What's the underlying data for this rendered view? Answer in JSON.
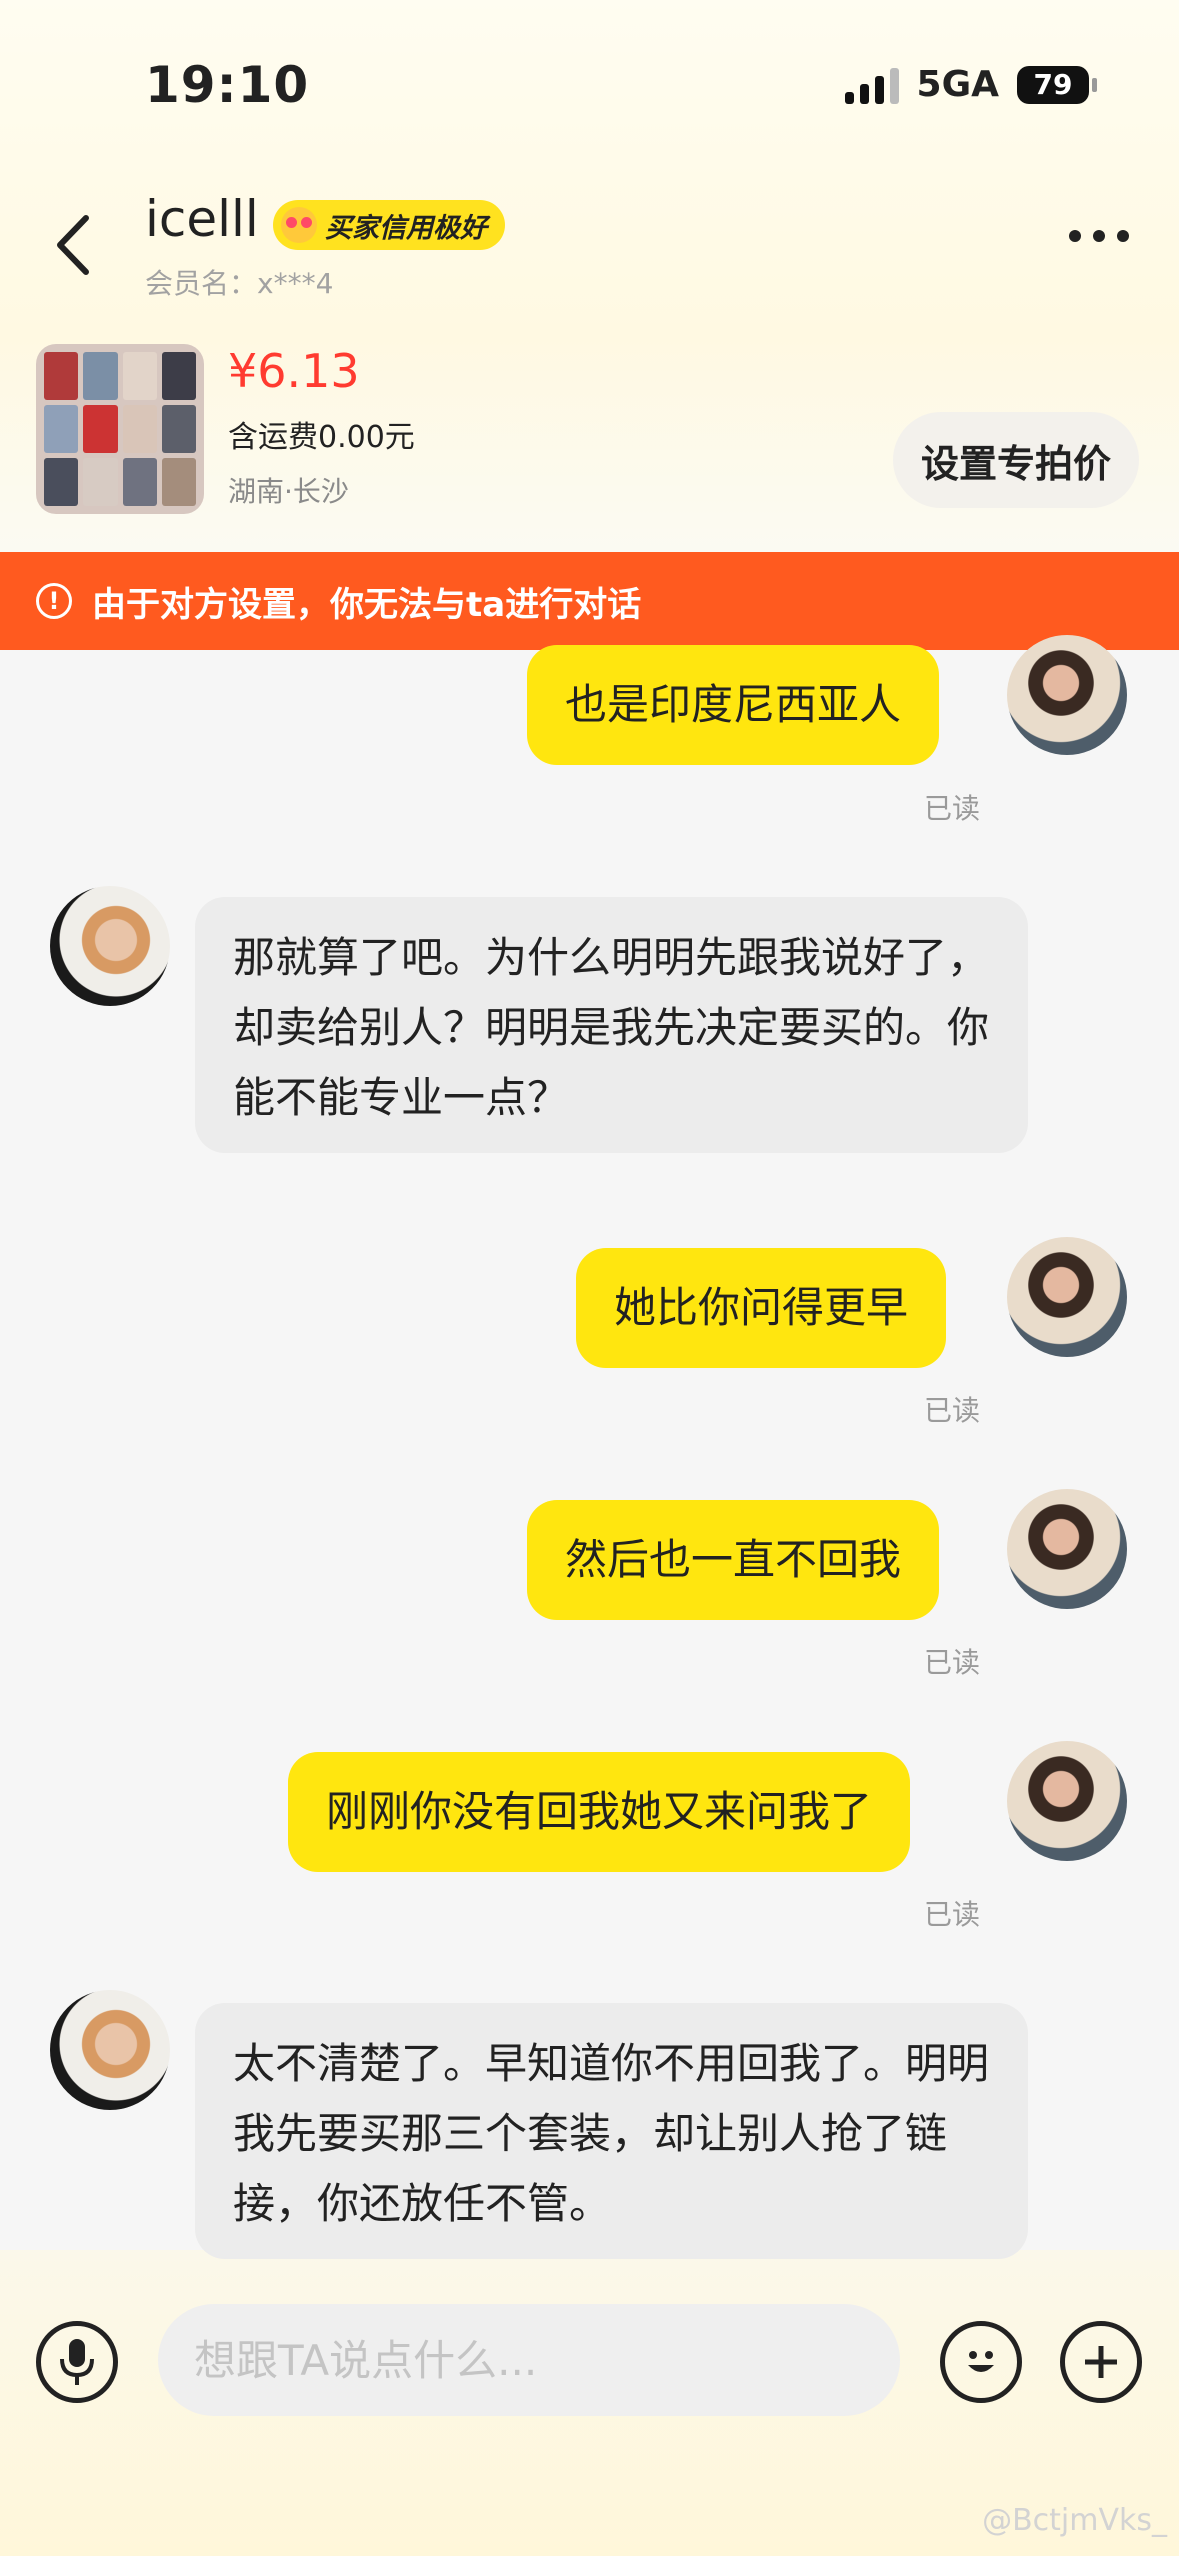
{
  "status_bar": {
    "time": "19:10",
    "network": "5GA",
    "battery": "79"
  },
  "header": {
    "contact_name": "icelll",
    "badge": "买家信用极好",
    "member_label": "会员名：x***4"
  },
  "product": {
    "price": "¥6.13",
    "shipping": "含运费0.00元",
    "location": "湖南·长沙",
    "set_price_button": "设置专拍价"
  },
  "banner": {
    "icon": "!",
    "text": "由于对方设置，你无法与ta进行对话"
  },
  "messages": [
    {
      "from": "me",
      "text": "也是印度尼西亚人",
      "status": "已读"
    },
    {
      "from": "them",
      "text": "那就算了吧。为什么明明先跟我说好了，却卖给别人？明明是我先决定要买的。你能不能专业一点？"
    },
    {
      "from": "me",
      "text": "她比你问得更早",
      "status": "已读"
    },
    {
      "from": "me",
      "text": "然后也一直不回我",
      "status": "已读"
    },
    {
      "from": "me",
      "text": "刚刚你没有回我她又来问我了",
      "status": "已读"
    },
    {
      "from": "them",
      "text": "太不清楚了。早知道你不用回我了。明明我先要买那三个套装，却让别人抢了链接，你还放任不管。"
    }
  ],
  "input": {
    "placeholder": "想跟TA说点什么..."
  },
  "watermark": "@BctjmVks_",
  "colors": {
    "accent_yellow": "#ffe60f",
    "banner_orange": "#ff5a1f",
    "price_red": "#ff3b30"
  }
}
